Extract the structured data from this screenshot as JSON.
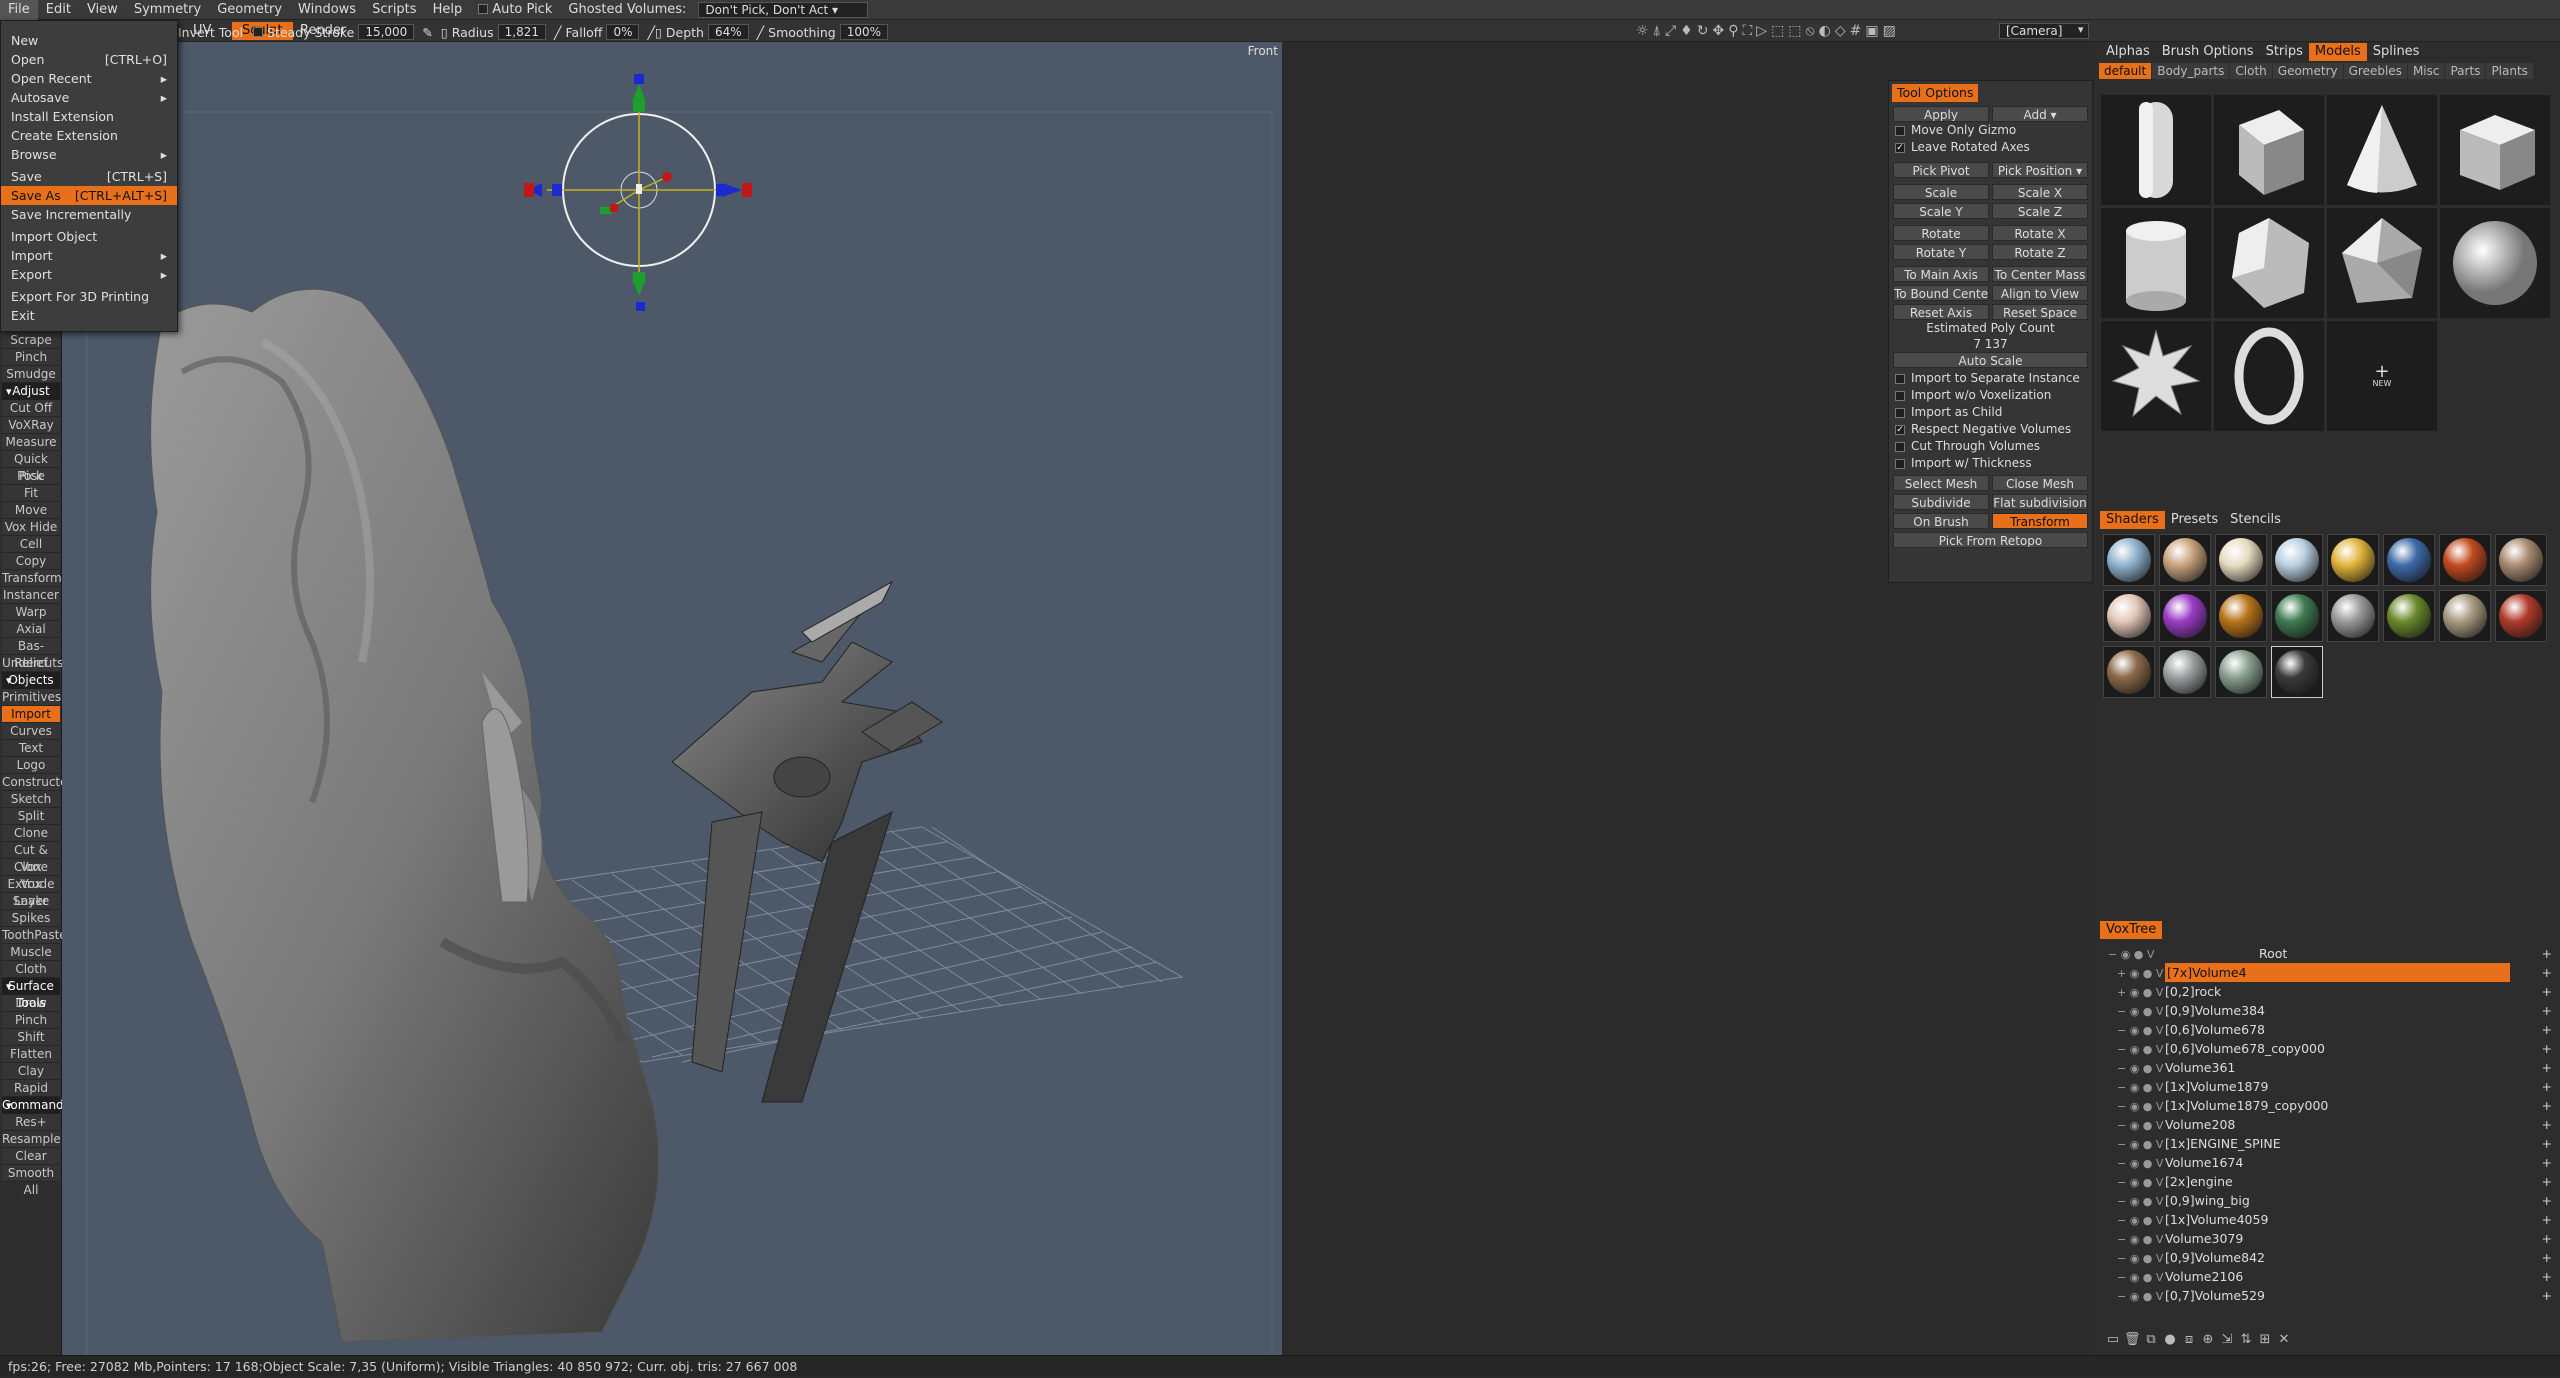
{
  "menubar": {
    "items": [
      "File",
      "Edit",
      "View",
      "Symmetry",
      "Geometry",
      "Windows",
      "Scripts",
      "Help"
    ],
    "auto_pick": "Auto Pick",
    "ghosted_label": "Ghosted Volumes:",
    "ghosted_value": "Don't Pick, Don't Act"
  },
  "toolbar": {
    "invert_tool": "Invert Tool",
    "steady_stroke": "Steady Stroke",
    "steady_value": "15,000",
    "radius_label": "Radius",
    "radius_value": "1,821",
    "falloff_label": "Falloff",
    "falloff_value": "0%",
    "depth_label": "Depth",
    "depth_value": "64%",
    "smoothing_label": "Smoothing",
    "smoothing_value": "100%",
    "camera_value": "[Camera]",
    "view_label": "Front"
  },
  "modes": {
    "uv": "UV",
    "sculpt": "Sculpt",
    "render": "Render"
  },
  "file_menu": {
    "new": "New",
    "open": "Open",
    "open_sc": "[CTRL+O]",
    "open_recent": "Open Recent",
    "autosave": "Autosave",
    "install_extension": "Install Extension",
    "create_extension": "Create Extension",
    "browse": "Browse",
    "save": "Save",
    "save_sc": "[CTRL+S]",
    "save_as": "Save As",
    "save_as_sc": "[CTRL+ALT+S]",
    "save_incrementally": "Save Incrementally",
    "import_object": "Import Object",
    "import": "Import",
    "export": "Export",
    "export_3d": "Export For 3D Printing",
    "exit": "Exit"
  },
  "left_panel": {
    "g1": [
      "Scrape",
      "Pinch",
      "Smudge"
    ],
    "adjust_head": "Adjust",
    "adjust": [
      "Cut Off",
      "VoXRay",
      "Measure",
      "Quick Pick",
      "Pose",
      "Fit",
      "Move",
      "Vox Hide",
      "Cell",
      "Copy",
      "Transform",
      "Instancer",
      "Warp",
      "Axial",
      "Bas-Relief",
      "Undercuts"
    ],
    "objects_head": "Objects",
    "objects": [
      "Primitives",
      "Import",
      "Curves",
      "Text",
      "Logo",
      "Constructor",
      "Sketch",
      "Split",
      "Clone",
      "Cut & Clone",
      "Vox Extrude",
      "Vox Layer",
      "Snake",
      "Spikes",
      "ToothPaste",
      "Muscle",
      "Cloth"
    ],
    "surface_head": "Surface Tools",
    "surface": [
      "Draw",
      "Pinch",
      "Shift",
      "Flatten",
      "Clay",
      "Rapid"
    ],
    "commands_head": "Commands",
    "commands": [
      "Res+",
      "Resample",
      "Clear",
      "Smooth All"
    ],
    "selected": "Import"
  },
  "tool_options": {
    "title": "Tool Options",
    "apply": "Apply",
    "add": "Add",
    "move_only_gizmo": "Move Only Gizmo",
    "leave_rotated_axes": "Leave Rotated Axes",
    "pick_pivot": "Pick Pivot",
    "pick_position": "Pick Position",
    "scale": "Scale",
    "scale_x": "Scale X",
    "scale_y": "Scale Y",
    "scale_z": "Scale Z",
    "rotate": "Rotate",
    "rotate_x": "Rotate X",
    "rotate_y": "Rotate Y",
    "rotate_z": "Rotate Z",
    "to_main_axis": "To Main Axis",
    "to_center_mass": "To Center Mass",
    "to_bound_center": "To Bound Cente",
    "align_to_view": "Align to View",
    "reset_axis": "Reset Axis",
    "reset_space": "Reset Space",
    "est_poly_label": "Estimated Poly Count",
    "est_poly_value": "7 137",
    "auto_scale": "Auto Scale",
    "import_separate": "Import to Separate Instance",
    "import_wo_vox": "Import w/o Voxelization",
    "import_child": "Import as Child",
    "respect_negative": "Respect Negative Volumes",
    "cut_through": "Cut Through Volumes",
    "import_thickness": "Import w/ Thickness",
    "select_mesh": "Select Mesh",
    "close_mesh": "Close Mesh",
    "subdivide": "Subdivide",
    "flat_subdivision": "Flat subdivision",
    "on_brush": "On Brush",
    "transform": "Transform",
    "pick_from_retopo": "Pick From Retopo"
  },
  "right_tabs": [
    "Alphas",
    "Brush Options",
    "Strips",
    "Models",
    "Splines"
  ],
  "right_tab_active": "Models",
  "model_subtabs": [
    "default",
    "Body_parts",
    "Cloth",
    "Geometry",
    "Greebles",
    "Misc",
    "Parts",
    "Plants"
  ],
  "models_new": "NEW",
  "shader_tabs": [
    "Shaders",
    "Presets",
    "Stencils"
  ],
  "shader_colors": [
    "#8fb3cf",
    "#c9a27c",
    "#e8dcc0",
    "#b9cfe0",
    "#e0b43a",
    "#3e6aa8",
    "#c24a1d",
    "#a88a70",
    "#e3c7b8",
    "#9b3cc7",
    "#b7741a",
    "#3e7a52",
    "#9a9a9a",
    "#6a8a2a",
    "#a89a80",
    "#b03a2a",
    "#8a6a4a",
    "#9aa0a0",
    "#8aa090",
    "#3a3a3a"
  ],
  "voxtree": {
    "title": "VoxTree",
    "root": "Root",
    "items": [
      "[7x]Volume4",
      "[0,2]rock",
      "[0,9]Volume384",
      "[0,6]Volume678",
      "[0,6]Volume678_copy000",
      "Volume361",
      "[1x]Volume1879",
      "[1x]Volume1879_copy000",
      "Volume208",
      "[1x]ENGINE_SPINE",
      "Volume1674",
      "[2x]engine",
      "[0,9]wing_big",
      "[1x]Volume4059",
      "Volume3079",
      "[0,9]Volume842",
      "Volume2106",
      "[0,7]Volume529"
    ],
    "selected": "[7x]Volume4"
  },
  "status": "fps:26;    Free: 27082 Mb,Pointers: 17 168;Object Scale: 7,35 (Uniform);  Visible Triangles: 40 850 972;  Curr. obj. tris: 27 667 008"
}
